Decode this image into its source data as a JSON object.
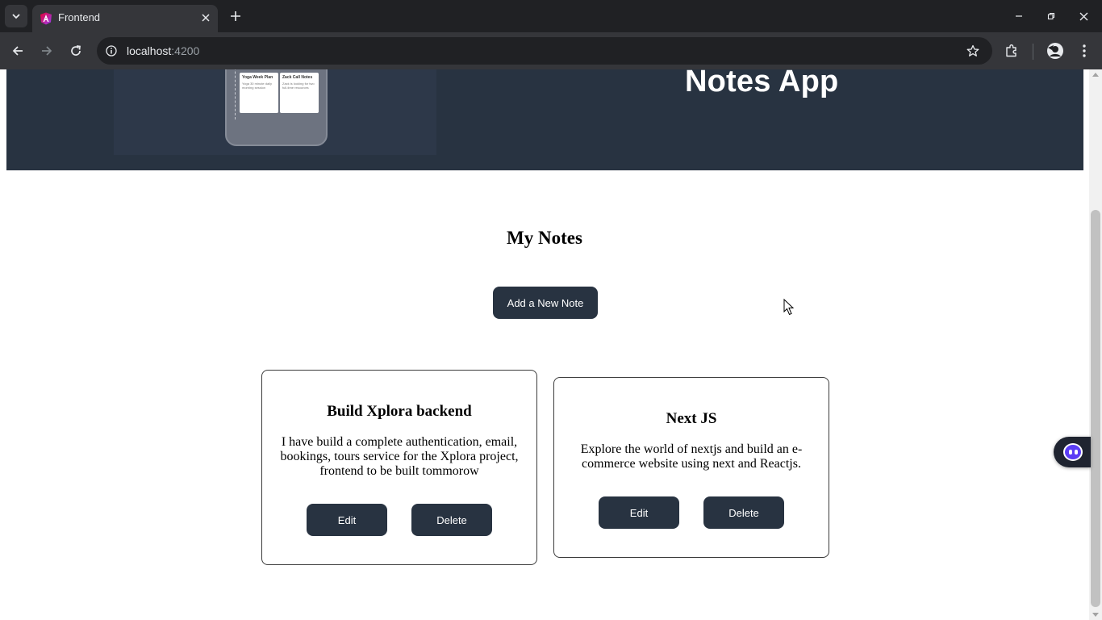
{
  "browser": {
    "tab_title": "Frontend",
    "url_host": "localhost",
    "url_port": ":4200"
  },
  "page": {
    "hero": {
      "title": "Notes App",
      "phone_cards": [
        {
          "title": "Yoga Week Plan",
          "body": "Yoga 30 minute daily morning session"
        },
        {
          "title": "Zack Call Notes",
          "body": "Zack is looking for two full-time resources"
        }
      ]
    },
    "heading": "My Notes",
    "add_button": "Add a New Note",
    "notes": [
      {
        "title": "Build Xplora backend",
        "body": "I have build a complete authentication, email, bookings, tours service for the Xplora project, frontend to be built tommorow",
        "edit_label": "Edit",
        "delete_label": "Delete"
      },
      {
        "title": "Next JS",
        "body": "Explore the world of nextjs and build an e-commerce website using next and Reactjs.",
        "edit_label": "Edit",
        "delete_label": "Delete"
      }
    ]
  },
  "colors": {
    "hero_bg": "#283341",
    "button_bg": "#283341",
    "chrome_dark": "#202124",
    "chrome_toolbar": "#35363a",
    "assistant_accent": "#5b3df5"
  },
  "icons": [
    "chevron-down-icon",
    "angular-favicon",
    "close-icon",
    "plus-icon",
    "minimize-icon",
    "restore-icon",
    "back-icon",
    "forward-icon",
    "reload-icon",
    "site-info-icon",
    "star-icon",
    "extensions-icon",
    "profile-icon",
    "menu-icon",
    "cursor-icon",
    "assistant-icon"
  ]
}
